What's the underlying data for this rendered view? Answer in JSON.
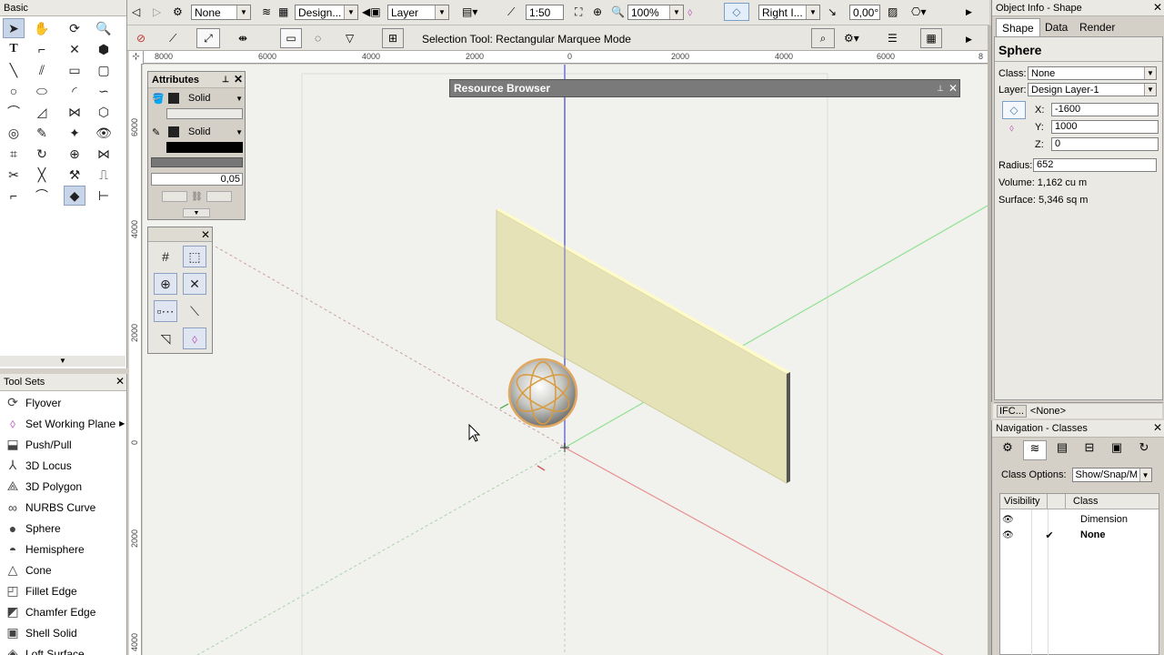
{
  "basic_palette": {
    "title": "Basic"
  },
  "top_toolbar": {
    "class_value": "None",
    "layer_mode_value": "Design...",
    "layer_value": "Layer",
    "scale_value": "1:50",
    "zoom_value": "100%",
    "view_value": "Right I...",
    "angle_value": "0,00°"
  },
  "mode_bar": {
    "status_text": "Selection Tool: Rectangular Marquee Mode"
  },
  "rulers": {
    "h_ticks": [
      "8000",
      "6000",
      "4000",
      "2000",
      "0",
      "2000",
      "4000",
      "6000",
      "8"
    ],
    "v_ticks": [
      "6000",
      "4000",
      "2000",
      "0",
      "2000",
      "4000"
    ]
  },
  "attributes": {
    "title": "Attributes",
    "fill_style": "Solid",
    "pen_style": "Solid",
    "line_thickness": "0,05"
  },
  "resource_browser": {
    "title": "Resource Browser"
  },
  "tool_sets": {
    "title": "Tool Sets",
    "items": [
      {
        "label": "Flyover",
        "icon": "flyover-icon"
      },
      {
        "label": "Set Working Plane",
        "icon": "working-plane-icon",
        "has_submenu": true
      },
      {
        "label": "Push/Pull",
        "icon": "push-pull-icon"
      },
      {
        "label": "3D Locus",
        "icon": "locus-icon"
      },
      {
        "label": "3D Polygon",
        "icon": "polygon-3d-icon"
      },
      {
        "label": "NURBS Curve",
        "icon": "nurbs-icon"
      },
      {
        "label": "Sphere",
        "icon": "sphere-icon"
      },
      {
        "label": "Hemisphere",
        "icon": "hemisphere-icon"
      },
      {
        "label": "Cone",
        "icon": "cone-icon"
      },
      {
        "label": "Fillet Edge",
        "icon": "fillet-icon"
      },
      {
        "label": "Chamfer Edge",
        "icon": "chamfer-icon"
      },
      {
        "label": "Shell Solid",
        "icon": "shell-icon"
      },
      {
        "label": "Loft Surface",
        "icon": "loft-icon"
      }
    ]
  },
  "object_info": {
    "title": "Object Info - Shape",
    "tabs": [
      "Shape",
      "Data",
      "Render"
    ],
    "object_type": "Sphere",
    "class_label": "Class:",
    "class_value": "None",
    "layer_label": "Layer:",
    "layer_value": "Design Layer-1",
    "x_label": "X:",
    "x_value": "-1600",
    "y_label": "Y:",
    "y_value": "1000",
    "z_label": "Z:",
    "z_value": "0",
    "radius_label": "Radius:",
    "radius_value": "652",
    "volume_text": "Volume: 1,162 cu m",
    "surface_text": "Surface: 5,346 sq m",
    "ifc_label": "IFC...",
    "ifc_value": "<None>"
  },
  "navigation": {
    "title": "Navigation - Classes",
    "class_options_label": "Class Options:",
    "class_options_value": "Show/Snap/M",
    "col_visibility": "Visibility",
    "col_class": "Class",
    "rows": [
      {
        "name": "Dimension",
        "active": false
      },
      {
        "name": "None",
        "active": true
      }
    ]
  },
  "colors": {
    "chrome": "#d4d0c8",
    "panel": "#ebe9e3",
    "canvas": "#f1f2ee",
    "wall": "#e6e2b7",
    "sphere_outline": "#d89a3a"
  }
}
